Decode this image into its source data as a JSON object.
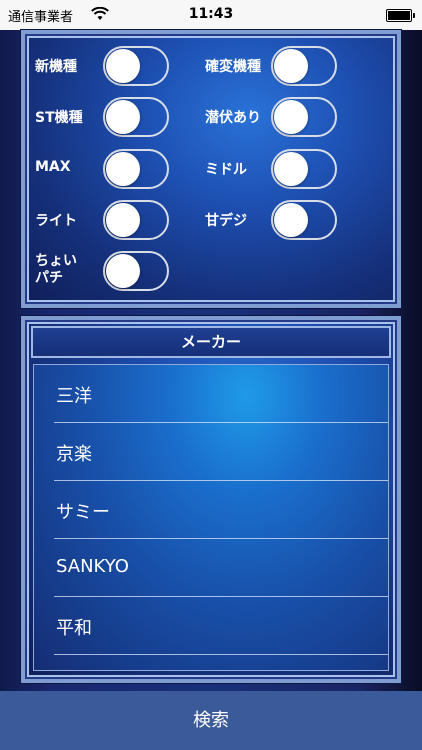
{
  "status_bar": {
    "carrier": "通信事業者",
    "time": "11:43"
  },
  "filters": [
    {
      "label": "新機種",
      "on": false
    },
    {
      "label": "確変機種",
      "on": false
    },
    {
      "label": "ST機種",
      "on": false
    },
    {
      "label": "潜伏あり",
      "on": false
    },
    {
      "label": "MAX",
      "on": false
    },
    {
      "label": "ミドル",
      "on": false
    },
    {
      "label": "ライト",
      "on": false
    },
    {
      "label": "甘デジ",
      "on": false
    },
    {
      "label_line1": "ちょい",
      "label_line2": "パチ",
      "on": false
    }
  ],
  "maker": {
    "header": "メーカー",
    "items": [
      "三洋",
      "京楽",
      "サミー",
      "SANKYO",
      "平和"
    ]
  },
  "search_button": "検索",
  "colors": {
    "search_bar": "#3b5a9a",
    "panel_border": "#7f9dd0"
  }
}
